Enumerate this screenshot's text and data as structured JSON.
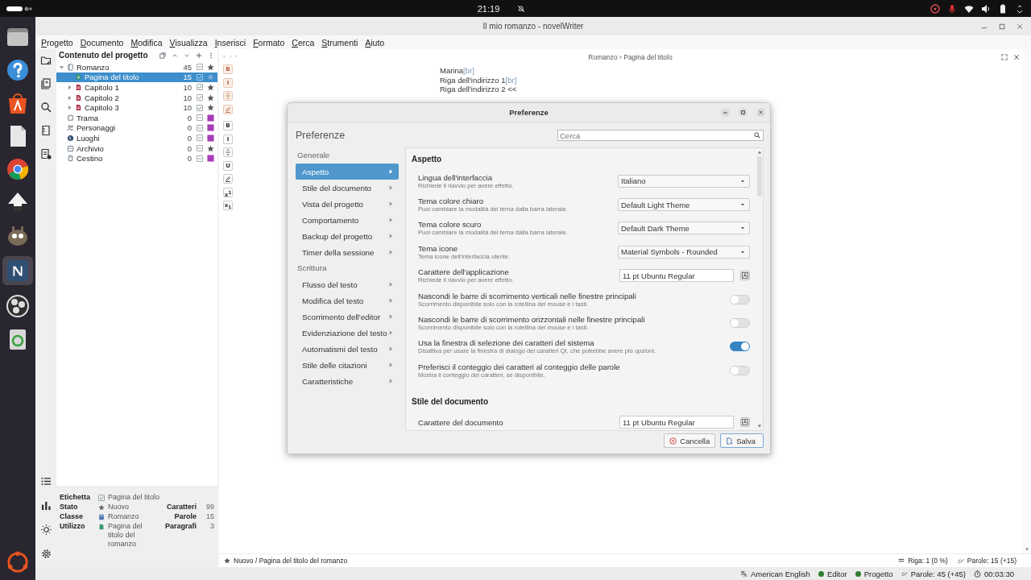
{
  "system_bar": {
    "time": "21:19"
  },
  "window": {
    "title": "Il mio romanzo - novelWriter"
  },
  "menu": [
    "Progetto",
    "Documento",
    "Modifica",
    "Visualizza",
    "Inserisci",
    "Formato",
    "Cerca",
    "Strumenti",
    "Aiuto"
  ],
  "project_tree": {
    "title": "Contenuto del progetto",
    "items": [
      {
        "kind": "novel",
        "label": "Romanzo",
        "count": "45",
        "checked": false,
        "marker": {
          "kind": "star"
        },
        "selected": false,
        "expanded": true,
        "children": [
          {
            "kind": "title",
            "label": "Pagina del titolo",
            "count": "15",
            "checked": true,
            "marker": {
              "kind": "star"
            },
            "selected": true
          },
          {
            "kind": "chapter",
            "label": "Capitolo 1",
            "count": "10",
            "checked": true,
            "marker": {
              "kind": "star"
            },
            "selected": false,
            "expanded": false
          },
          {
            "kind": "chapter",
            "label": "Capitolo 2",
            "count": "10",
            "checked": true,
            "marker": {
              "kind": "star"
            },
            "selected": false,
            "expanded": false
          },
          {
            "kind": "chapter",
            "label": "Capitolo 3",
            "count": "10",
            "checked": true,
            "marker": {
              "kind": "star"
            },
            "selected": false,
            "expanded": false
          }
        ]
      },
      {
        "kind": "plot",
        "label": "Trama",
        "count": "0",
        "checked": false,
        "marker": {
          "kind": "square",
          "color": "#a83cb8"
        },
        "selected": false
      },
      {
        "kind": "characters",
        "label": "Personaggi",
        "count": "0",
        "checked": false,
        "marker": {
          "kind": "square",
          "color": "#a83cb8"
        },
        "selected": false
      },
      {
        "kind": "locations",
        "label": "Luoghi",
        "count": "0",
        "checked": false,
        "marker": {
          "kind": "square",
          "color": "#a83cb8"
        },
        "selected": false
      },
      {
        "kind": "archive",
        "label": "Archivio",
        "count": "0",
        "checked": false,
        "marker": {
          "kind": "star"
        },
        "selected": false
      },
      {
        "kind": "trash",
        "label": "Cestino",
        "count": "0",
        "checked": false,
        "marker": {
          "kind": "square",
          "color": "#a83cb8"
        },
        "selected": false
      }
    ]
  },
  "details": {
    "rows": [
      {
        "kind": "label",
        "label": "Etichetta",
        "value": "Pagina del titolo"
      },
      {
        "kind": "status",
        "label": "Stato",
        "value": "Nuovo"
      },
      {
        "kind": "class",
        "label": "Classe",
        "value": "Romanzo"
      },
      {
        "kind": "usage",
        "label": "Utilizzo",
        "value": "Pagina del titolo del romanzo"
      }
    ],
    "stats": [
      {
        "label": "Caratteri",
        "value": "99"
      },
      {
        "label": "Parole",
        "value": "15"
      },
      {
        "label": "Paragrafi",
        "value": "3"
      }
    ]
  },
  "format_buttons": [
    {
      "kind": "mdtext",
      "label": "B"
    },
    {
      "kind": "mdtext",
      "label": "I"
    },
    {
      "kind": "mdstrike"
    },
    {
      "kind": "mdmark"
    },
    {
      "kind": "sctext",
      "label": "B"
    },
    {
      "kind": "sctext",
      "label": "I"
    },
    {
      "kind": "scstrike"
    },
    {
      "kind": "sctext",
      "label": "U"
    },
    {
      "kind": "scmark"
    },
    {
      "kind": "sctext",
      "label": "x$^{1}$"
    },
    {
      "kind": "sctext",
      "label": "x$_{1}$"
    }
  ],
  "editor": {
    "breadcrumb": "Romanzo › Pagina del titolo",
    "lines": [
      {
        "text": "Marina",
        "tag": "[br]"
      },
      {
        "text": "Riga dell'indirizzo 1",
        "tag": "[br]"
      },
      {
        "text": "Riga dell'indirizzo 2 <<"
      }
    ],
    "footer": {
      "status": "Nuovo / Pagina del titolo del romanzo",
      "line": "Riga: 1 (0 %)",
      "words": "Parole: 15 (+15)"
    }
  },
  "status_bar": {
    "language": "American English",
    "editor": "Editor",
    "project": "Progetto",
    "words": "Parole: 45 (+45)",
    "time": "00:03:30"
  },
  "dialog": {
    "title": "Preferenze",
    "heading": "Preferenze",
    "search_placeholder": "Cerca",
    "nav": [
      {
        "kind": "group",
        "label": "Generale"
      },
      {
        "kind": "item",
        "label": "Aspetto",
        "selected": true
      },
      {
        "kind": "item",
        "label": "Stile del documento",
        "selected": false
      },
      {
        "kind": "item",
        "label": "Vista del progetto",
        "selected": false
      },
      {
        "kind": "item",
        "label": "Comportamento",
        "selected": false
      },
      {
        "kind": "item",
        "label": "Backup del progetto",
        "selected": false
      },
      {
        "kind": "item",
        "label": "Timer della sessione",
        "selected": false
      },
      {
        "kind": "group",
        "label": "Scrittura"
      },
      {
        "kind": "item",
        "label": "Flusso del testo",
        "selected": false
      },
      {
        "kind": "item",
        "label": "Modifica del testo",
        "selected": false
      },
      {
        "kind": "item",
        "label": "Scorrimento dell'editor",
        "selected": false
      },
      {
        "kind": "item",
        "label": "Evidenziazione del testo",
        "selected": false
      },
      {
        "kind": "item",
        "label": "Automatismi del testo",
        "selected": false
      },
      {
        "kind": "item",
        "label": "Stile delle citazioni",
        "selected": false
      },
      {
        "kind": "item",
        "label": "Caratteristiche",
        "selected": false
      }
    ],
    "sections": [
      {
        "title": "Aspetto",
        "settings": [
          {
            "kind": "select",
            "label": "Lingua dell'interfaccia",
            "hint": "Richiede il riavvio per avere effetto.",
            "value": "Italiano"
          },
          {
            "kind": "select",
            "label": "Tema colore chiaro",
            "hint": "Puoi cambiare la modalità del tema dalla barra laterale.",
            "value": "Default Light Theme"
          },
          {
            "kind": "select",
            "label": "Tema colore scuro",
            "hint": "Puoi cambiare la modalità del tema dalla barra laterale.",
            "value": "Default Dark Theme"
          },
          {
            "kind": "select",
            "label": "Tema icone",
            "hint": "Tema icone dell'interfaccia utente.",
            "value": "Material Symbols - Rounded"
          },
          {
            "kind": "font",
            "label": "Carattere dell'applicazione",
            "hint": "Richiede il riavvio per avere effetto.",
            "value": "11 pt Ubuntu Regular"
          },
          {
            "kind": "switch",
            "label": "Nascondi le barre di scorrimento verticali nelle finestre principali",
            "hint": "Scorrimento disponibile solo con la rotellina del mouse e i tasti.",
            "on": false
          },
          {
            "kind": "switch",
            "label": "Nascondi le barre di scorrimento orizzontali nelle finestre principali",
            "hint": "Scorrimento disponibile solo con la rotellina del mouse e i tasti.",
            "on": false
          },
          {
            "kind": "switch",
            "label": "Usa la finestra di selezione dei caratteri del sistema",
            "hint": "Disattiva per usare la finestra di dialogo dei caratteri Qt, che potrebbe avere più opzioni.",
            "on": true
          },
          {
            "kind": "switch",
            "label": "Preferisci il conteggio dei caratteri al conteggio delle parole",
            "hint": "Mostra il conteggio dei caratteri, se disponibile.",
            "on": false
          }
        ]
      },
      {
        "title": "Stile del documento",
        "settings": [
          {
            "kind": "font",
            "label": "Carattere del documento",
            "value": "11 pt Ubuntu Regular"
          }
        ]
      }
    ],
    "buttons": [
      {
        "kind": "cancel",
        "label": "Cancella"
      },
      {
        "kind": "save",
        "label": "Salva"
      }
    ]
  }
}
